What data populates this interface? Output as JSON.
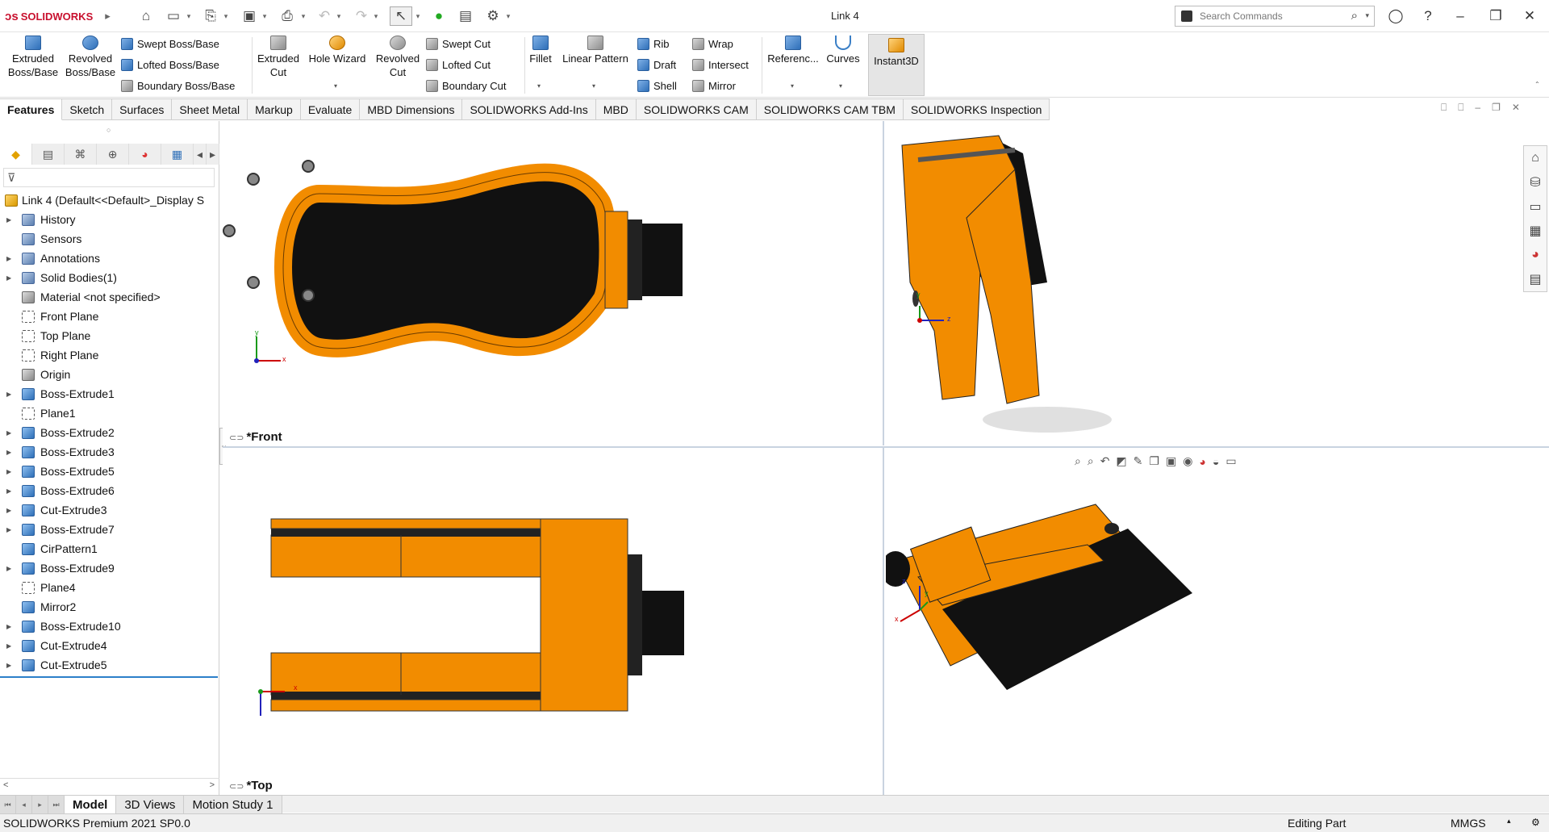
{
  "app": {
    "logo_text": "SOLIDWORKS",
    "document_title": "Link 4"
  },
  "search": {
    "placeholder": "Search Commands"
  },
  "ribbon": {
    "extruded_boss": "Extruded Boss/Base",
    "revolved_boss": "Revolved Boss/Base",
    "swept_boss": "Swept Boss/Base",
    "lofted_boss": "Lofted Boss/Base",
    "boundary_boss": "Boundary Boss/Base",
    "extruded_cut": "Extruded Cut",
    "hole_wizard": "Hole Wizard",
    "revolved_cut": "Revolved Cut",
    "swept_cut": "Swept Cut",
    "lofted_cut": "Lofted Cut",
    "boundary_cut": "Boundary Cut",
    "fillet": "Fillet",
    "linear_pattern": "Linear Pattern",
    "rib": "Rib",
    "draft": "Draft",
    "shell": "Shell",
    "wrap": "Wrap",
    "intersect": "Intersect",
    "mirror": "Mirror",
    "reference": "Referenc...",
    "curves": "Curves",
    "instant3d": "Instant3D"
  },
  "command_tabs": [
    "Features",
    "Sketch",
    "Surfaces",
    "Sheet Metal",
    "Markup",
    "Evaluate",
    "MBD Dimensions",
    "SOLIDWORKS Add-Ins",
    "MBD",
    "SOLIDWORKS CAM",
    "SOLIDWORKS CAM TBM",
    "SOLIDWORKS Inspection"
  ],
  "tree": {
    "root": "Link 4  (Default<<Default>_Display S",
    "items": [
      "History",
      "Sensors",
      "Annotations",
      "Solid Bodies(1)",
      "Material <not specified>",
      "Front Plane",
      "Top Plane",
      "Right Plane",
      "Origin",
      "Boss-Extrude1",
      "Plane1",
      "Boss-Extrude2",
      "Boss-Extrude3",
      "Boss-Extrude5",
      "Boss-Extrude6",
      "Cut-Extrude3",
      "Boss-Extrude7",
      "CirPattern1",
      "Boss-Extrude9",
      "Plane4",
      "Mirror2",
      "Boss-Extrude10",
      "Cut-Extrude4",
      "Cut-Extrude5"
    ]
  },
  "viewports": {
    "front_label": "*Front",
    "top_label": "*Top"
  },
  "axes": {
    "x": "x",
    "y": "y",
    "z": "z"
  },
  "bottom_tabs": [
    "Model",
    "3D Views",
    "Motion Study 1"
  ],
  "status": {
    "product": "SOLIDWORKS Premium 2021 SP0.0",
    "mode": "Editing Part",
    "units": "MMGS"
  },
  "colors": {
    "part_orange": "#F28C00",
    "part_black": "#111111",
    "accent_red": "#C8102E"
  }
}
